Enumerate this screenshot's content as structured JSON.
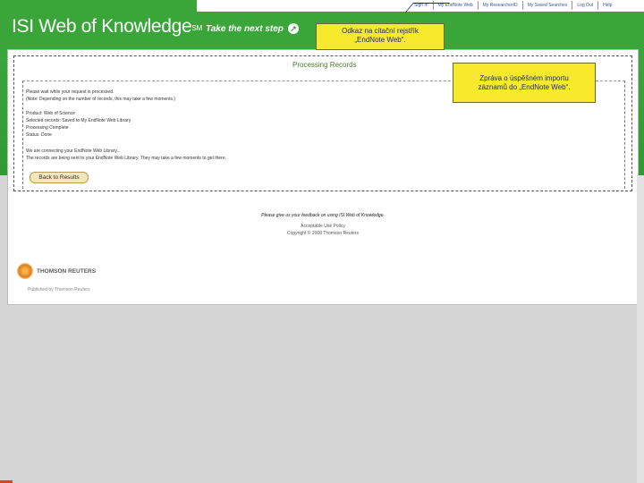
{
  "header": {
    "logo_text": "ISI Web of Knowledge",
    "logo_sup": "SM",
    "tagline": "Take the next step",
    "tagline_icon": "arrow-circle-icon",
    "nav": [
      "Sign In",
      "My EndNote Web",
      "My ResearcherID",
      "My Saved Searches",
      "Log Out",
      "Help"
    ]
  },
  "callouts": {
    "link_note_line1": "Odkaz na citační rejstřík",
    "link_note_line2": "„EndNote Web“.",
    "import_note_line1": "Zpráva o úspěšném importu",
    "import_note_line2": "záznamů do „EndNote Web“."
  },
  "page": {
    "title": "Processing Records",
    "lines": [
      "Please wait while your request is processed.",
      "(Note: Depending on the number of records, this may take a few moments.)",
      "Product: Web of Science",
      "Selected records: Saved to My EndNote Web Library",
      "Processing Complete",
      "Status: Done",
      "We are connecting your EndNote Web Library...",
      "The records are being sent to your EndNote Web Library. They may take a few moments to get there."
    ],
    "back_button": "Back to Results"
  },
  "footer": {
    "feedback": "Please give us your feedback on using ISI Web of Knowledge.",
    "policy": "Acceptable Use Policy",
    "copyright": "Copyright © 2008 Thomson Reuters",
    "company": "THOMSON REUTERS",
    "tagline": "Published by Thomson Reuters"
  }
}
